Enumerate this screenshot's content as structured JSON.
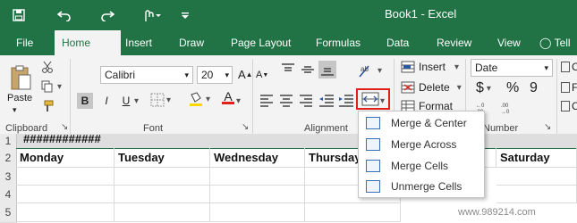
{
  "titlebar": {
    "title": "Book1  -  Excel",
    "save_icon": "save-icon",
    "undo_icon": "undo-icon",
    "redo_icon": "redo-icon",
    "touch_icon": "touch-mode-icon",
    "customize_icon": "customize-qat-icon",
    "tell_me_icon": "lightbulb-icon"
  },
  "tabs": [
    "File",
    "Home",
    "Insert",
    "Draw",
    "Page Layout",
    "Formulas",
    "Data",
    "Review",
    "View",
    "Tell"
  ],
  "ribbon": {
    "clipboard": {
      "paste_label": "Paste",
      "group_label": "Clipboard"
    },
    "font": {
      "font_name": "Calibri",
      "font_size": "20",
      "group_label": "Font",
      "bold": "B",
      "italic": "I",
      "underline": "U",
      "font_color_glyph": "A"
    },
    "alignment": {
      "group_label": "Alignment"
    },
    "cells": {
      "insert_label": "Insert",
      "delete_label": "Delete",
      "format_label": "Format"
    },
    "number": {
      "format_value": "Date",
      "currency_glyph": "$",
      "percent_glyph": "%",
      "comma_glyph": "9",
      "group_label": "Number"
    },
    "styles": {
      "item1": "Co",
      "item2": "Fo",
      "item3": "Ce"
    }
  },
  "merge_dropdown": {
    "items": [
      "Merge & Center",
      "Merge Across",
      "Merge Cells",
      "Unmerge Cells"
    ]
  },
  "sheet": {
    "row_numbers": [
      "1",
      "2",
      "3",
      "4",
      "5"
    ],
    "row1_text": "############",
    "headers": [
      "Monday",
      "Tuesday",
      "Wednesday",
      "Thursday",
      "Saturday"
    ]
  },
  "watermark": "www.989214.com",
  "colors": {
    "excel_green": "#217346",
    "highlight_red": "#e0201b"
  }
}
